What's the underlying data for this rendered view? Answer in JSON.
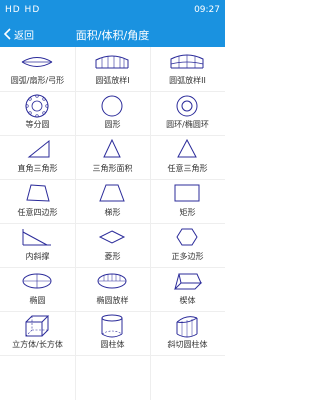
{
  "status": {
    "left": "HD HD",
    "time": "09:27"
  },
  "header": {
    "back_label": "返回",
    "title": "面积/体积/角度"
  },
  "items": [
    {
      "label": "圆弧/扇形/弓形",
      "icon": "arc-sector-icon"
    },
    {
      "label": "圆弧放样I",
      "icon": "arc-loft-1-icon"
    },
    {
      "label": "圆弧放样II",
      "icon": "arc-loft-2-icon"
    },
    {
      "label": "等分圆",
      "icon": "divided-circle-icon"
    },
    {
      "label": "圆形",
      "icon": "circle-icon"
    },
    {
      "label": "圆环/椭圆环",
      "icon": "ring-icon"
    },
    {
      "label": "直角三角形",
      "icon": "right-triangle-icon"
    },
    {
      "label": "三角形面积",
      "icon": "triangle-area-icon"
    },
    {
      "label": "任意三角形",
      "icon": "any-triangle-icon"
    },
    {
      "label": "任意四边形",
      "icon": "quadrilateral-icon"
    },
    {
      "label": "梯形",
      "icon": "trapezoid-icon"
    },
    {
      "label": "矩形",
      "icon": "rectangle-icon"
    },
    {
      "label": "内斜撑",
      "icon": "inner-brace-icon"
    },
    {
      "label": "菱形",
      "icon": "rhombus-icon"
    },
    {
      "label": "正多边形",
      "icon": "regular-polygon-icon"
    },
    {
      "label": "椭圆",
      "icon": "ellipse-icon"
    },
    {
      "label": "椭圆放样",
      "icon": "ellipse-loft-icon"
    },
    {
      "label": "楔体",
      "icon": "wedge-icon"
    },
    {
      "label": "立方体/长方体",
      "icon": "cuboid-icon"
    },
    {
      "label": "圆柱体",
      "icon": "cylinder-icon"
    },
    {
      "label": "斜切圆柱体",
      "icon": "oblique-cylinder-icon"
    }
  ]
}
